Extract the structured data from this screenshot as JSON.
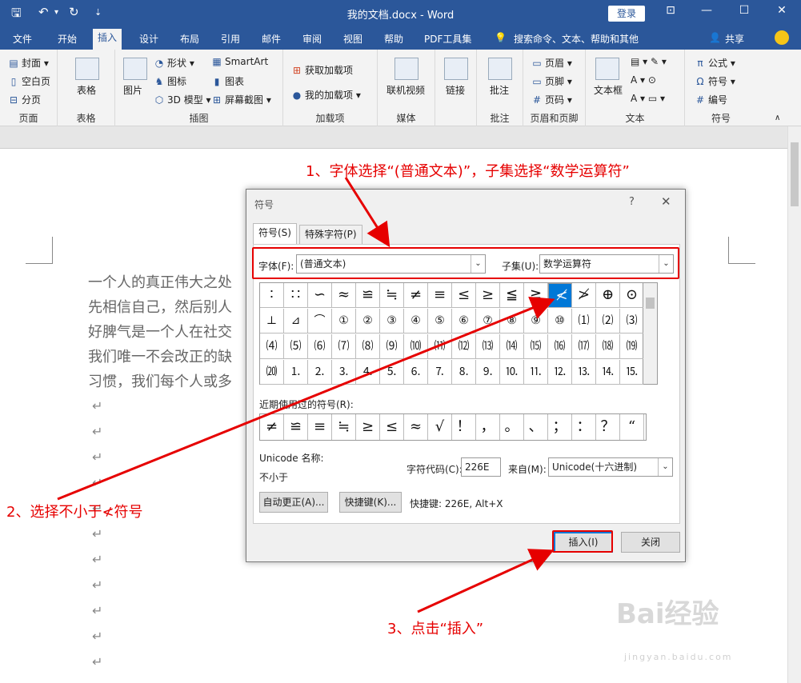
{
  "titlebar": {
    "title": "我的文档.docx  -  Word",
    "login": "登录"
  },
  "menu": {
    "tabs": [
      "文件",
      "开始",
      "插入",
      "设计",
      "布局",
      "引用",
      "邮件",
      "审阅",
      "视图",
      "帮助",
      "PDF工具集"
    ],
    "search": "搜索命令、文本、帮助和其他",
    "share": "共享"
  },
  "ribbon": {
    "page": {
      "cover": "封面",
      "blank": "空白页",
      "break": "分页",
      "label": "页面"
    },
    "table": {
      "btn": "表格",
      "label": "表格"
    },
    "illus": {
      "picture": "图片",
      "shapes": "形状",
      "icons": "图标",
      "model3d": "3D 模型",
      "smartart": "SmartArt",
      "chart": "图表",
      "screenshot": "屏幕截图",
      "label": "插图"
    },
    "addins": {
      "get": "获取加载项",
      "mine": "我的加载项",
      "label": "加载项"
    },
    "media": {
      "video": "联机视频",
      "label": "媒体"
    },
    "links": {
      "link": "链接"
    },
    "comments": {
      "comment": "批注",
      "label": "批注"
    },
    "hf": {
      "header": "页眉",
      "footer": "页脚",
      "pageno": "页码",
      "label": "页眉和页脚"
    },
    "text": {
      "textbox": "文本框",
      "label": "文本"
    },
    "symbols": {
      "equation": "公式",
      "symbol": "符号",
      "number": "编号",
      "label": "符号"
    }
  },
  "document": {
    "lines": [
      "一个人的真正伟大之处",
      "先相信自己，然后别人",
      "好脾气是一个人在社交",
      "我们唯一不会改正的缺",
      "习惯，我们每个人或多"
    ],
    "para_mark": "↵"
  },
  "dialog": {
    "title": "符号",
    "help": "?",
    "close_x": "✕",
    "tab_symbols": "符号(S)",
    "tab_special": "特殊字符(P)",
    "font_label": "字体(F):",
    "font_value": "(普通文本)",
    "subset_label": "子集(U):",
    "subset_value": "数学运算符",
    "grid": [
      [
        "∶",
        "∷",
        "∽",
        "≈",
        "≌",
        "≒",
        "≠",
        "≡",
        "≤",
        "≥",
        "≦",
        "≧",
        "≮",
        "≯",
        "⊕",
        "⊙"
      ],
      [
        "⊥",
        "⊿",
        "⌒",
        "①",
        "②",
        "③",
        "④",
        "⑤",
        "⑥",
        "⑦",
        "⑧",
        "⑨",
        "⑩",
        "⑴",
        "⑵",
        "⑶"
      ],
      [
        "⑷",
        "⑸",
        "⑹",
        "⑺",
        "⑻",
        "⑼",
        "⑽",
        "⑾",
        "⑿",
        "⒀",
        "⒁",
        "⒂",
        "⒃",
        "⒄",
        "⒅",
        "⒆"
      ],
      [
        "⒇",
        "⒈",
        "⒉",
        "⒊",
        "⒋",
        "⒌",
        "⒍",
        "⒎",
        "⒏",
        "⒐",
        "⒑",
        "⒒",
        "⒓",
        "⒔",
        "⒕",
        "⒖"
      ]
    ],
    "selected": {
      "row": 0,
      "col": 12
    },
    "recent_label": "近期使用过的符号(R):",
    "recent": [
      "≠",
      "≌",
      "≡",
      "≒",
      "≥",
      "≤",
      "≈",
      "√",
      "！",
      "，",
      "。",
      "、",
      "；",
      "：",
      "？",
      "“"
    ],
    "unicode_name_label": "Unicode 名称:",
    "unicode_name": "不小于",
    "charcode_label": "字符代码(C):",
    "charcode": "226E",
    "from_label": "来自(M):",
    "from_value": "Unicode(十六进制)",
    "autocorrect": "自动更正(A)...",
    "shortcut_btn": "快捷键(K)...",
    "shortcut_text": "快捷键: 226E, Alt+X",
    "insert": "插入(I)",
    "close": "关闭"
  },
  "annotations": {
    "step1": "1、字体选择“(普通文本)”，子集选择“数学运算符”",
    "step2": "2、选择不小于≮符号",
    "step3": "3、点击“插入”",
    "color": "#e60000"
  },
  "watermark": {
    "brand": "Bai经验",
    "url": "jingyan.baidu.com"
  }
}
